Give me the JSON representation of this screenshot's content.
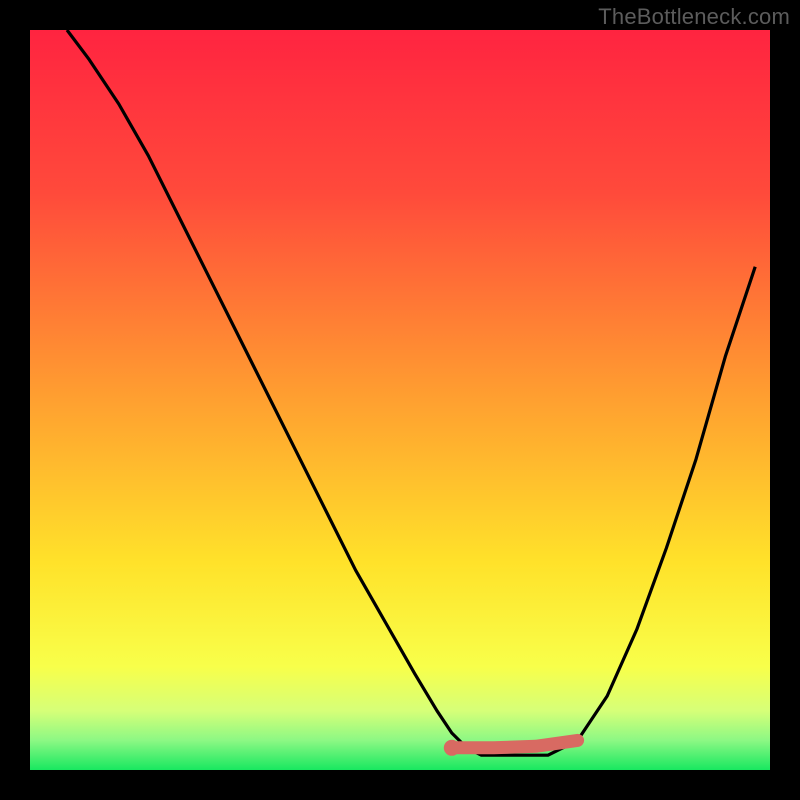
{
  "watermark": "TheBottleneck.com",
  "gradient": {
    "c0": "#ff2440",
    "c1": "#ff4a3b",
    "c2": "#ffa030",
    "c3": "#ffe22a",
    "c4": "#f8ff4a",
    "c5": "#d6ff78",
    "c6": "#8cf884",
    "c7": "#18e860"
  },
  "curve_color": "#000000",
  "highlight_color": "#d86a62",
  "chart_data": {
    "type": "line",
    "title": "",
    "xlabel": "",
    "ylabel": "",
    "xlim": [
      0,
      100
    ],
    "ylim": [
      0,
      100
    ],
    "grid": false,
    "series": [
      {
        "name": "curve",
        "x": [
          5,
          8,
          12,
          16,
          20,
          24,
          28,
          32,
          36,
          40,
          44,
          48,
          52,
          55,
          57,
          59,
          61,
          65,
          70,
          74,
          78,
          82,
          86,
          90,
          94,
          98
        ],
        "values": [
          100,
          96,
          90,
          83,
          75,
          67,
          59,
          51,
          43,
          35,
          27,
          20,
          13,
          8,
          5,
          3,
          2,
          2,
          2,
          4,
          10,
          19,
          30,
          42,
          56,
          68
        ]
      }
    ],
    "highlight_segment": {
      "name": "bottom-band",
      "x": [
        57,
        74
      ],
      "values": [
        3,
        4
      ]
    },
    "highlight_start_dot": {
      "x": 57,
      "y": 3
    }
  }
}
